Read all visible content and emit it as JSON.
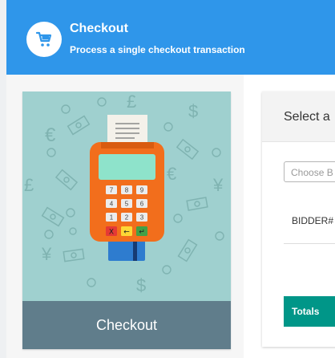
{
  "header": {
    "title": "Checkout",
    "subtitle": "Process a single checkout transaction",
    "icon": "shopping-cart-icon",
    "background": "#2f96ea"
  },
  "card": {
    "label": "Checkout",
    "illustration": "card-payment-terminal",
    "footer_color": "#607d8b",
    "illustration_bg": "#9fd0cf"
  },
  "terminal": {
    "keys": [
      "7",
      "8",
      "9",
      "4",
      "5",
      "6",
      "1",
      "2",
      "3"
    ],
    "cancel_key": "X",
    "clear_key": "←",
    "ok_key": "↵"
  },
  "currency_symbols": [
    "£",
    "€",
    "$",
    "€",
    "£",
    "¥",
    "¥",
    "$"
  ],
  "panel": {
    "title": "Select a",
    "select_placeholder": "Choose B",
    "column_header": "BIDDER#",
    "totals_label": "Totals",
    "totals_color": "#009688"
  }
}
